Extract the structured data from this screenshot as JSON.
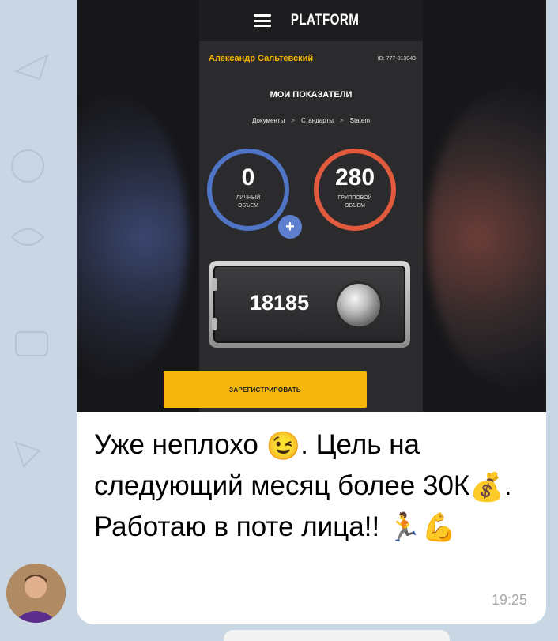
{
  "colors": {
    "chat_background": "#c9d7e4",
    "bubble": "#ffffff",
    "accent_yellow": "#f6b70d",
    "personal_ring": "#5075c7",
    "group_ring": "#e25a3d",
    "timestamp": "#a7a7a7"
  },
  "photo": {
    "app_brand": "PLATFORM",
    "menu_icon": "hamburger-icon",
    "user_name": "Александр Сальтевский",
    "user_id": "ID: 777-013043",
    "section_title": "МОИ ПОКАЗАТЕЛИ",
    "tabs": [
      "Документы",
      "Стандарты",
      "Statem"
    ],
    "tab_separator": ">",
    "personal_volume": {
      "value": "0",
      "label_line1": "ЛИЧНЫЙ",
      "label_line2": "ОБЪЕМ"
    },
    "group_volume": {
      "value": "280",
      "label_line1": "ГРУППОВОЙ",
      "label_line2": "ОБЪЕМ"
    },
    "add_icon": "plus-icon",
    "safe_value": "18185",
    "safe_icon": "vault-dial-icon",
    "register_button": "ЗАРЕГИСТРИРОВАТЬ"
  },
  "message": {
    "text_part1": "Уже неплохо ",
    "text_part2": ". Цель на следующий месяц более 30К",
    "text_part3": ". Работаю в поте лица!! ",
    "emoji1": "😉",
    "emoji2": "💰",
    "emoji3": "🏃",
    "emoji4": "💪",
    "time": "19:25"
  }
}
